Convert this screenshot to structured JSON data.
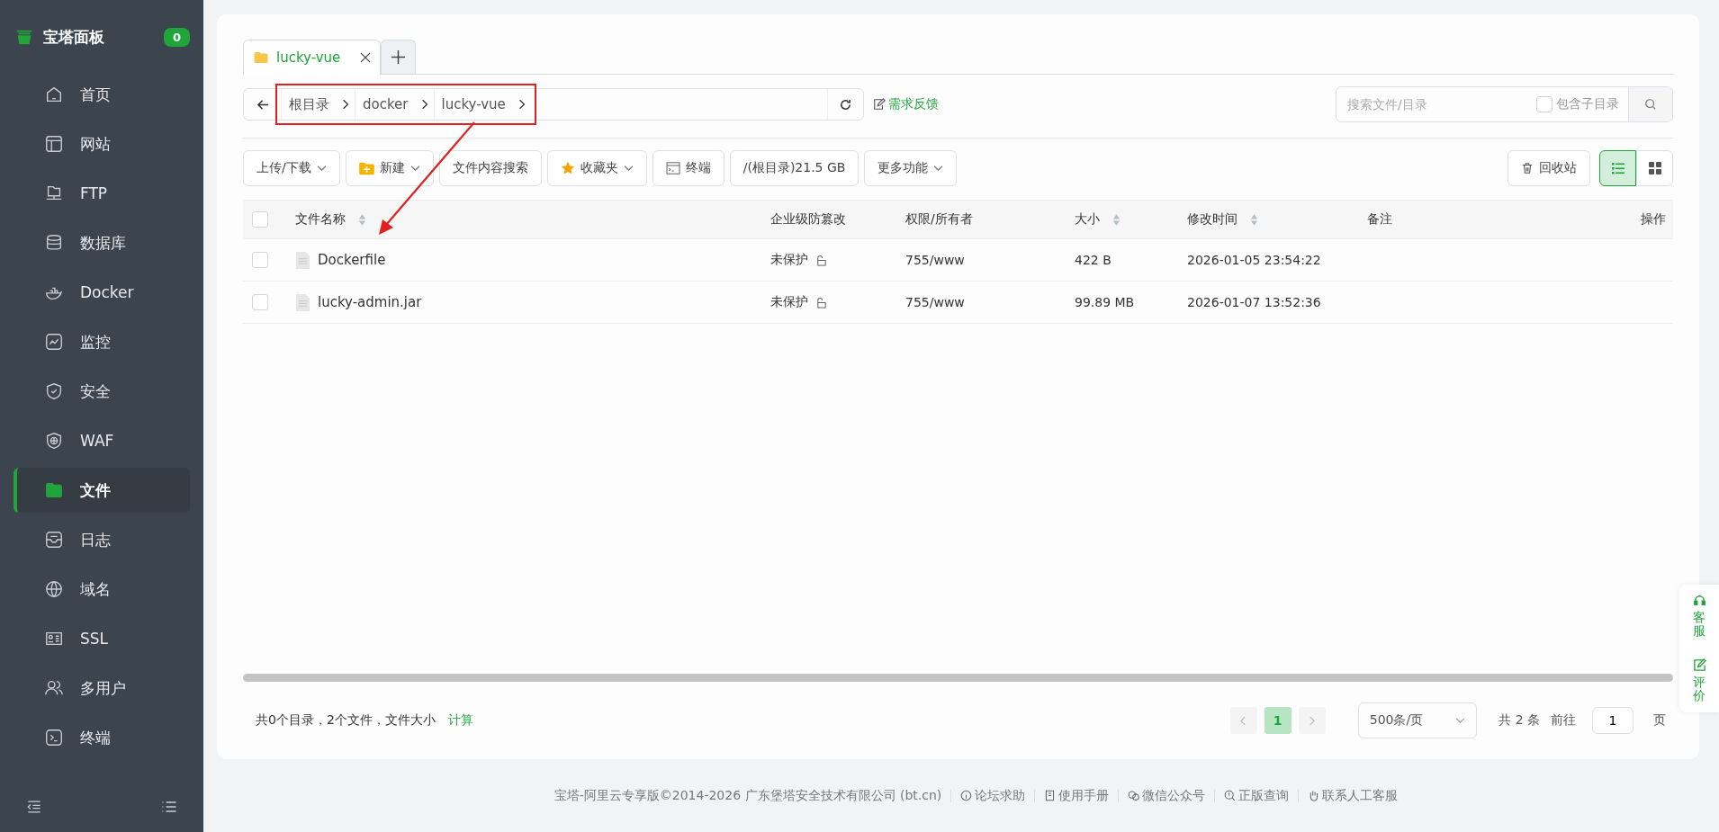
{
  "sidebar": {
    "logo": "宝塔面板",
    "badge": "0",
    "items": [
      {
        "label": "首页",
        "selected": false
      },
      {
        "label": "网站",
        "selected": false
      },
      {
        "label": "FTP",
        "selected": false
      },
      {
        "label": "数据库",
        "selected": false
      },
      {
        "label": "Docker",
        "selected": false
      },
      {
        "label": "监控",
        "selected": false
      },
      {
        "label": "安全",
        "selected": false
      },
      {
        "label": "WAF",
        "selected": false
      },
      {
        "label": "文件",
        "selected": true
      },
      {
        "label": "日志",
        "selected": false
      },
      {
        "label": "域名",
        "selected": false
      },
      {
        "label": "SSL",
        "selected": false
      },
      {
        "label": "多用户",
        "selected": false
      },
      {
        "label": "终端",
        "selected": false
      }
    ]
  },
  "tabs": [
    {
      "label": "lucky-vue",
      "selected": true
    }
  ],
  "breadcrumb": [
    "根目录",
    "docker",
    "lucky-vue"
  ],
  "feedback": "需求反馈",
  "search": {
    "placeholder": "搜索文件/目录",
    "include_sub": {
      "label": "包含子目录",
      "checked": false
    }
  },
  "toolbar": [
    {
      "label": "上传/下载",
      "dropdown": true
    },
    {
      "label": "新建",
      "dropdown": true
    },
    {
      "label": "文件内容搜索",
      "dropdown": false
    },
    {
      "label": "收藏夹",
      "dropdown": true
    },
    {
      "label": "终端",
      "dropdown": false
    },
    {
      "label": "/(根目录)21.5 GB",
      "dropdown": false
    },
    {
      "label": "更多功能",
      "dropdown": true
    }
  ],
  "recycle": "回收站",
  "views": [
    {
      "kind": "list",
      "selected": true
    },
    {
      "kind": "grid",
      "selected": false
    }
  ],
  "table": {
    "select_all_checked": false,
    "columns": [
      {
        "label": "文件名称",
        "sortable": true
      },
      {
        "label": "企业级防篡改",
        "sortable": false
      },
      {
        "label": "权限/所有者",
        "sortable": false
      },
      {
        "label": "大小",
        "sortable": true
      },
      {
        "label": "修改时间",
        "sortable": true
      },
      {
        "label": "备注",
        "sortable": false
      },
      {
        "label": "操作",
        "sortable": false
      }
    ],
    "rows": [
      {
        "checked": false,
        "name": "Dockerfile",
        "protect": "未保护",
        "perm": "755/www",
        "size": "422 B",
        "mtime": "2026-01-05 23:54:22"
      },
      {
        "checked": false,
        "name": "lucky-admin.jar",
        "protect": "未保护",
        "perm": "755/www",
        "size": "99.89 MB",
        "mtime": "2026-01-07 13:52:36"
      }
    ]
  },
  "summary": {
    "text": "共0个目录，2个文件，文件大小",
    "link": "计算"
  },
  "pagination": {
    "pages": [
      {
        "label": "1",
        "selected": true
      }
    ],
    "page_size": "500条/页",
    "total": "共 2 条",
    "goto": "前往",
    "goto_value": "1",
    "unit": "页"
  },
  "footer": {
    "copyright": "宝塔-阿里云专享版©2014-2026 广东堡塔安全技术有限公司 (bt.cn)",
    "links": [
      "论坛求助",
      "使用手册",
      "微信公众号",
      "正版查询",
      "联系人工客服"
    ]
  },
  "float_widget": [
    "客服",
    "评价"
  ]
}
